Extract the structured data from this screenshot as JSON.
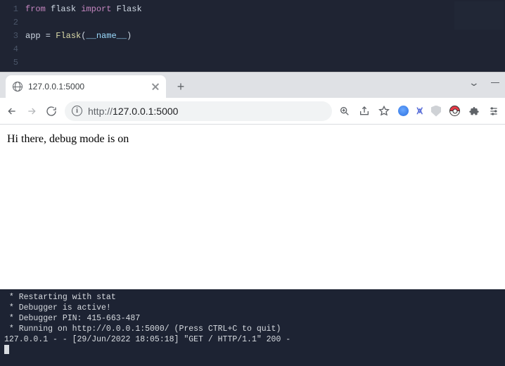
{
  "editor": {
    "lines": [
      {
        "n": "1",
        "html": "<span class='kw'>from</span> flask <span class='kw'>import</span> Flask"
      },
      {
        "n": "2",
        "html": ""
      },
      {
        "n": "3",
        "html": "app = <span class='fn'>Flask</span>(<span class='var'>__name__</span>)"
      },
      {
        "n": "4",
        "html": ""
      },
      {
        "n": "5",
        "html": ""
      }
    ]
  },
  "browser": {
    "tab_title": "127.0.0.1:5000",
    "url_scheme": "http://",
    "url_rest": "127.0.0.1:5000"
  },
  "page_body": "Hi there, debug mode is on",
  "terminal_lines": [
    " * Restarting with stat",
    " * Debugger is active!",
    " * Debugger PIN: 415-663-487",
    " * Running on http://0.0.0.1:5000/ (Press CTRL+C to quit)",
    "127.0.0.1 - - [29/Jun/2022 18:05:18] \"GET / HTTP/1.1\" 200 -"
  ]
}
